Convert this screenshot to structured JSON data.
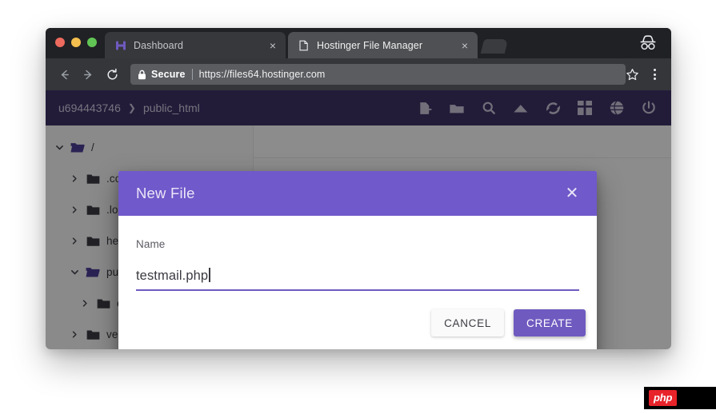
{
  "browser": {
    "traffic_lights": [
      "close",
      "minimize",
      "maximize"
    ],
    "tabs": [
      {
        "title": "Dashboard",
        "favicon": "hostinger-h-icon",
        "active": false,
        "close_label": "×"
      },
      {
        "title": "Hostinger File Manager",
        "favicon": "page-icon",
        "active": true,
        "close_label": "×"
      }
    ],
    "incognito_icon": "incognito-icon",
    "nav": {
      "back": "←",
      "forward": "→",
      "reload": "⟳"
    },
    "omnibox": {
      "security_label": "Secure",
      "url": "https://files64.hostinger.com",
      "lock_icon": "lock-icon",
      "star_icon": "star-icon",
      "menu_icon": "kebab-menu-icon"
    }
  },
  "app": {
    "breadcrumb": {
      "root": "u694443746",
      "separator": "❯",
      "current": "public_html"
    },
    "toolbar_icons": [
      "new-file-icon",
      "new-folder-icon",
      "search-icon",
      "upload-icon",
      "refresh-icon",
      "apps-grid-icon",
      "globe-icon",
      "power-icon"
    ],
    "file_tree": [
      {
        "label": "/",
        "expanded": true,
        "depth": 0,
        "open_folder": true
      },
      {
        "label": ".con",
        "expanded": false,
        "depth": 1,
        "open_folder": false
      },
      {
        "label": ".log",
        "expanded": false,
        "depth": 1,
        "open_folder": false
      },
      {
        "label": "hell",
        "expanded": false,
        "depth": 1,
        "open_folder": false
      },
      {
        "label": "pub",
        "expanded": true,
        "depth": 1,
        "open_folder": true
      },
      {
        "label": "example",
        "expanded": false,
        "depth": 2,
        "open_folder": false
      },
      {
        "label": "vendor",
        "expanded": false,
        "depth": 1,
        "open_folder": false
      }
    ]
  },
  "dialog": {
    "title": "New File",
    "close_label": "✕",
    "name_label": "Name",
    "name_value": "testmail.php",
    "name_placeholder": "",
    "cancel_label": "CANCEL",
    "create_label": "CREATE"
  },
  "watermark": {
    "text": "php"
  },
  "colors": {
    "app_header_purple": "#3f3469",
    "dialog_purple": "#7059ca",
    "accent_purple": "#6f5ac0",
    "browser_dark": "#202124",
    "omnibox_gray": "#5a5c60",
    "php_red": "#e8232a"
  }
}
